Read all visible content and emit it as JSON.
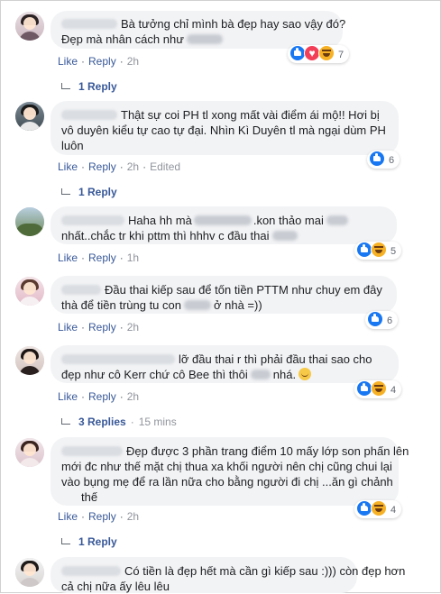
{
  "actions": {
    "like": "Like",
    "reply": "Reply",
    "separator": "·"
  },
  "comments": [
    {
      "lines": [
        "Bà tưởng chỉ mình bà đẹp hay sao vậy đó?",
        "Đẹp mà nhân cách như"
      ],
      "time": "2h",
      "edited": "",
      "reactions": [
        "like",
        "love",
        "haha"
      ],
      "reaction_count": "7",
      "replies_label": "1 Reply",
      "replies_time": ""
    },
    {
      "lines": [
        "Thật sự coi PH tl xong mất vài điểm ái mộ!! Hơi bị",
        "vô duyên kiểu tự cao tự đại. Nhìn Kì Duyên tl mà ngại dùm PH",
        "luôn"
      ],
      "time": "2h",
      "edited": "Edited",
      "reactions": [
        "like"
      ],
      "reaction_count": "6",
      "replies_label": "1 Reply",
      "replies_time": ""
    },
    {
      "lines": [
        "Haha hh mà",
        ".kon thảo mai",
        "nhất..chắc tr khi pttm thì hhhv c đầu thai"
      ],
      "time": "1h",
      "edited": "",
      "reactions": [
        "like",
        "haha"
      ],
      "reaction_count": "5",
      "replies_label": "",
      "replies_time": ""
    },
    {
      "lines": [
        "Đầu thai kiếp sau để tốn tiền PTTM như chuy em đây",
        "thà để tiền trùng tu con",
        "ở nhà =))"
      ],
      "time": "2h",
      "edited": "",
      "reactions": [
        "like"
      ],
      "reaction_count": "6",
      "replies_label": "",
      "replies_time": ""
    },
    {
      "lines": [
        "lỡ đầu thai r thì phải đầu thai sao cho",
        "đẹp như cô Kerr chứ cô Bee thì thôi",
        "nhá."
      ],
      "time": "2h",
      "edited": "",
      "reactions": [
        "like",
        "haha"
      ],
      "reaction_count": "4",
      "replies_label": "3 Replies",
      "replies_time": "15 mins"
    },
    {
      "lines": [
        "Đẹp được 3 phần trang điểm 10 mấy lớp son phấn lên",
        "mới đc như thế mặt chị thua xa khối người nên chị cũng chui lại",
        "vào bụng mẹ để ra lần nữa cho bằng người đi chị ...ăn gì chảnh",
        "thế"
      ],
      "time": "2h",
      "edited": "",
      "reactions": [
        "like",
        "haha"
      ],
      "reaction_count": "4",
      "replies_label": "1 Reply",
      "replies_time": ""
    },
    {
      "lines": [
        "Có tiền là đẹp hết mà cần gì kiếp sau :))) còn đẹp hơn",
        "cả chị nữa ấy lêu lêu"
      ],
      "time": "",
      "edited": "",
      "reactions": [],
      "reaction_count": "",
      "replies_label": "",
      "replies_time": ""
    }
  ],
  "colors": {
    "link": "#385898",
    "bubble": "#f2f3f5",
    "like_blue": "#1877f2",
    "haha_yellow": "#f7b125",
    "love_red": "#f33e58"
  }
}
